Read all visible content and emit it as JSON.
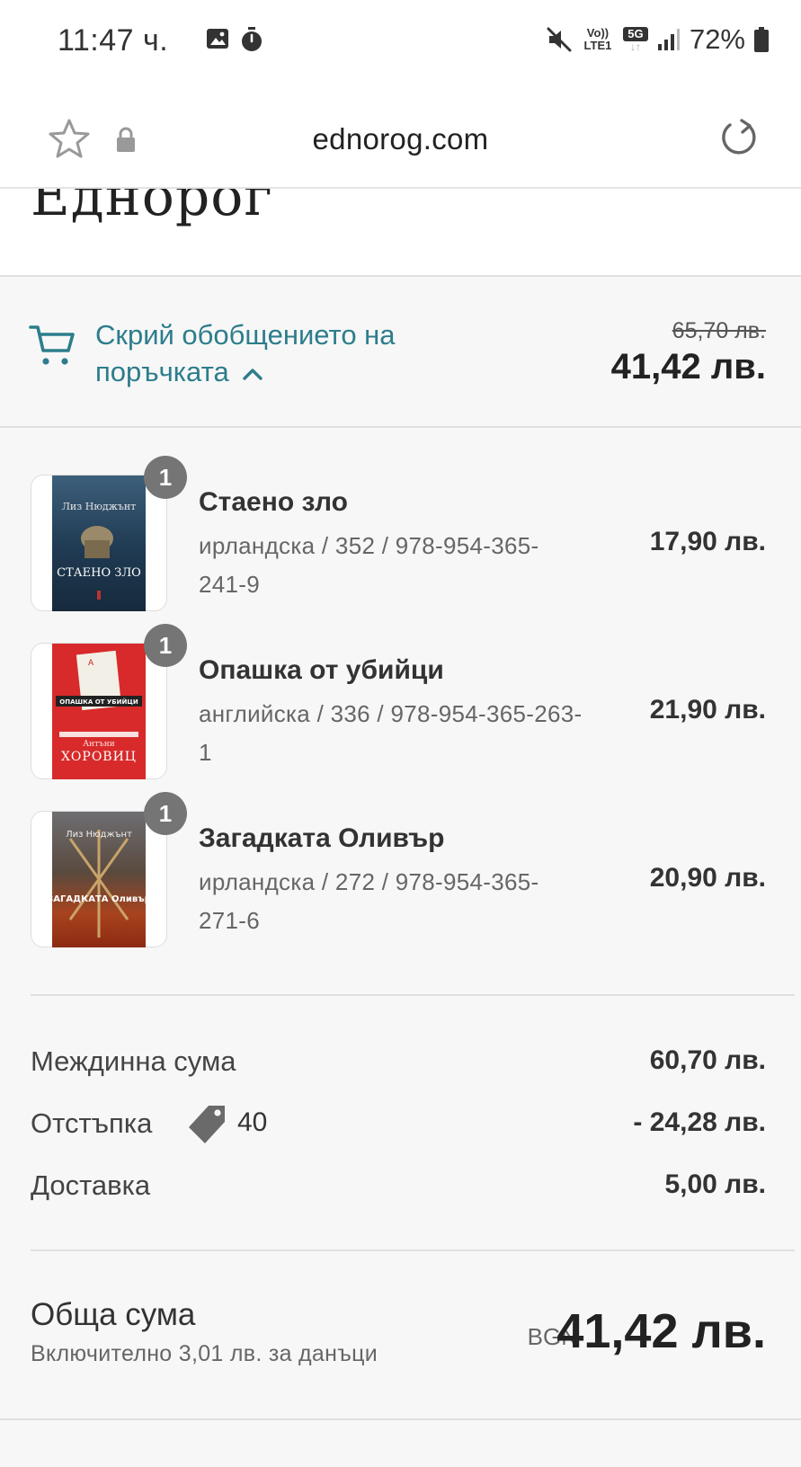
{
  "status_bar": {
    "time": "11:47 ч.",
    "battery": "72%",
    "network_volte": "Vo))",
    "network_lte": "LTE1",
    "network_5g": "5G"
  },
  "browser": {
    "url": "ednorog.com"
  },
  "store": {
    "logo_text": "Еднорог"
  },
  "order_summary": {
    "toggle_label": "Скрий обобщението на поръчката",
    "original_total": "65,70 лв.",
    "total": "41,42 лв.",
    "accent_color": "#2d7d8c"
  },
  "items": [
    {
      "quantity": "1",
      "title": "Стаено зло",
      "meta": "ирландска / 352 / 978-954-365-241-9",
      "price": "17,90 лв.",
      "cover_author": "Лиз Нюджънт",
      "cover_title": "СТАЕНО ЗЛО"
    },
    {
      "quantity": "1",
      "title": "Опашка от убийци",
      "meta": "английска / 336 / 978-954-365-263-1",
      "price": "21,90 лв.",
      "cover_author": "Антъни",
      "cover_title": "ХОРОВИЦ",
      "cover_band": "ОПАШКА ОТ УБИЙЦИ"
    },
    {
      "quantity": "1",
      "title": "Загадката Оливър",
      "meta": "ирландска / 272 / 978-954-365-271-6",
      "price": "20,90 лв.",
      "cover_author": "Лиз Нюджънт",
      "cover_title": "ЗАГАДКАТА Оливър"
    }
  ],
  "totals": {
    "subtotal_label": "Междинна сума",
    "subtotal_value": "60,70 лв.",
    "discount_label": "Отстъпка",
    "discount_code": "40",
    "discount_value": "- 24,28 лв.",
    "shipping_label": "Доставка",
    "shipping_value": "5,00 лв.",
    "total_label": "Обща сума",
    "tax_note": "Включително 3,01 лв. за данъци",
    "currency": "BGN",
    "grand_total": "41,42 лв."
  }
}
